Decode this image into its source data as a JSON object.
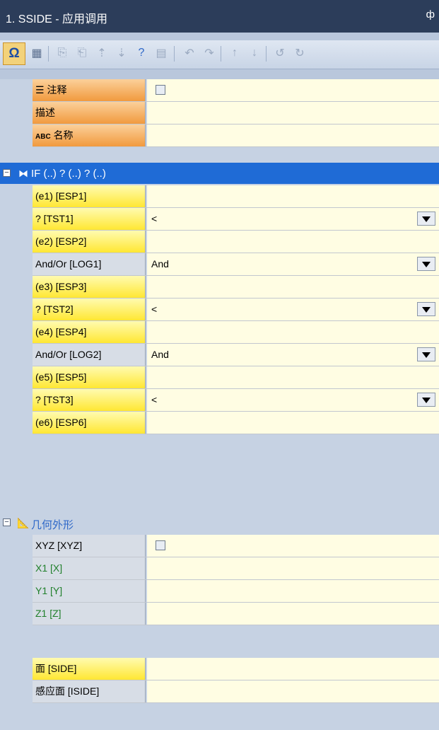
{
  "window": {
    "title": "1. SSIDE - 应用调用",
    "pin_glyph": "ф"
  },
  "toolbar": {
    "icons": [
      "omega-icon",
      "grid-icon",
      "copy-icon",
      "paste-icon",
      "sort-up-icon",
      "sort-down-icon",
      "bracket-question-icon",
      "table-icon",
      "undo-step-icon",
      "redo-step-icon",
      "move-up-icon",
      "move-down-icon",
      "rotate-left-icon",
      "rotate-right-icon"
    ]
  },
  "rows_top": [
    {
      "label": "注释",
      "icon": "list-icon",
      "kind": "checkbox",
      "value": ""
    },
    {
      "label": "描述",
      "kind": "text",
      "value": ""
    },
    {
      "label": "名称",
      "prefix": "ABC",
      "kind": "text",
      "value": ""
    }
  ],
  "section_if": {
    "title": "IF (..) ? (..) ? (..)"
  },
  "rows_if": [
    {
      "label": "(e1) [ESP1]",
      "value": ""
    },
    {
      "label": "? [TST1]",
      "value": "<",
      "dropdown": true
    },
    {
      "label": "(e2) [ESP2]",
      "value": ""
    },
    {
      "label": "And/Or [LOG1]",
      "value": "And",
      "dropdown": true
    },
    {
      "label": "(e3) [ESP3]",
      "value": ""
    },
    {
      "label": "? [TST2]",
      "value": "<",
      "dropdown": true
    },
    {
      "label": "(e4) [ESP4]",
      "value": ""
    },
    {
      "label": "And/Or [LOG2]",
      "value": "And",
      "dropdown": true
    },
    {
      "label": "(e5) [ESP5]",
      "value": ""
    },
    {
      "label": "? [TST3]",
      "value": "<",
      "dropdown": true
    },
    {
      "label": "(e6) [ESP6]",
      "value": ""
    }
  ],
  "section_geo": {
    "title": "几何外形"
  },
  "rows_geo": [
    {
      "label": "XYZ [XYZ]",
      "kind": "checkbox"
    },
    {
      "label": "X1 [X]",
      "value": ""
    },
    {
      "label": "Y1 [Y]",
      "value": ""
    },
    {
      "label": "Z1 [Z]",
      "value": ""
    }
  ],
  "rows_bottom": [
    {
      "label": "面 [SIDE]",
      "value": ""
    },
    {
      "label": "感应面 [ISIDE]",
      "value": ""
    }
  ],
  "colors": {
    "title_bg": "#2c3d5a",
    "selected": "#1f6bd6",
    "value_bg": "#fffde3",
    "orange": "#f19a3e",
    "yellow": "#ffe733"
  }
}
